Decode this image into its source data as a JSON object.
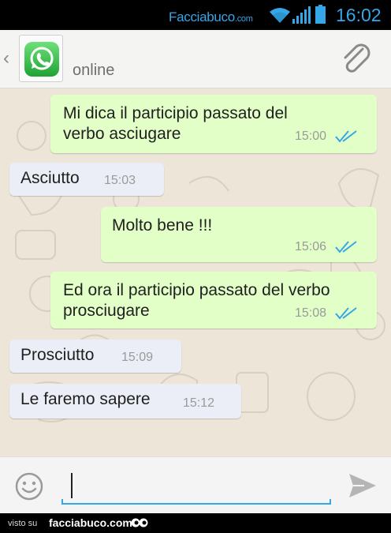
{
  "status_bar": {
    "watermark_main": "Facciabuco",
    "watermark_domain": ".com",
    "time": "16:02",
    "icons": [
      "wifi-icon",
      "signal-icon",
      "battery-icon"
    ],
    "accent": "#35a6e8"
  },
  "app_bar": {
    "back_icon": "chevron-left-icon",
    "avatar_icon": "whatsapp-logo-icon",
    "status": "online",
    "attach_icon": "paperclip-icon"
  },
  "messages": [
    {
      "direction": "out",
      "text_lines": [
        "Mi dica il participio passato del",
        "verbo asciugare"
      ],
      "time": "15:00",
      "read": true
    },
    {
      "direction": "in",
      "text_lines": [
        "Asciutto"
      ],
      "time": "15:03"
    },
    {
      "direction": "out",
      "text_lines": [
        "Molto bene !!!"
      ],
      "time": "15:06",
      "read": true
    },
    {
      "direction": "out",
      "text_lines": [
        "Ed ora il participio passato del verbo",
        "prosciugare"
      ],
      "time": "15:08",
      "read": true
    },
    {
      "direction": "in",
      "text_lines": [
        "Prosciutto"
      ],
      "time": "15:09"
    },
    {
      "direction": "in",
      "text_lines": [
        "Le faremo sapere"
      ],
      "time": "15:12"
    }
  ],
  "input_bar": {
    "emoji_icon": "smiley-icon",
    "value": "",
    "send_icon": "send-icon"
  },
  "footer": {
    "visto": "visto su",
    "site": "facciabuco.com",
    "eyes_icon": "eyes-icon"
  },
  "colors": {
    "outgoing_bubble": "#e2ffc7",
    "incoming_bubble": "#ebeef6",
    "chat_background": "#ece5d8",
    "read_ticks": "#35a6e8"
  }
}
